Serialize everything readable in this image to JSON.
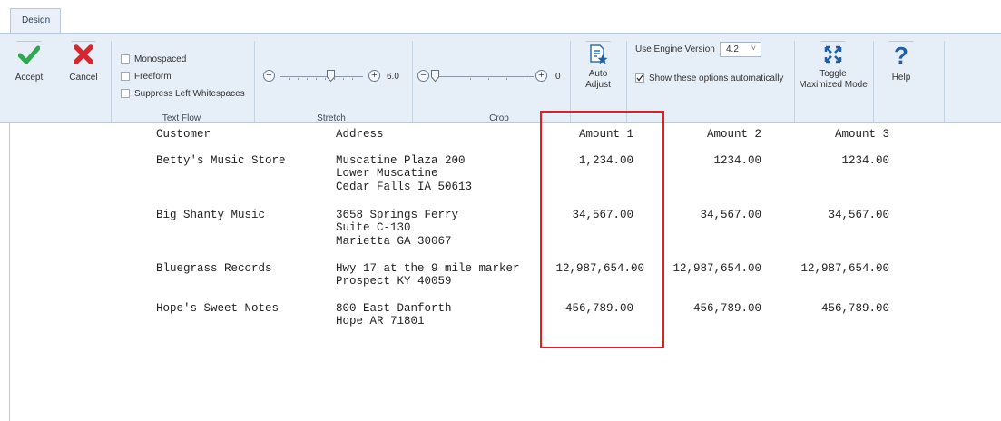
{
  "tabs": [
    {
      "label": "Design"
    }
  ],
  "ribbon": {
    "accept": "Accept",
    "cancel": "Cancel",
    "text_flow": {
      "options": [
        "Monospaced",
        "Freeform",
        "Suppress Left Whitespaces"
      ],
      "label": "Text Flow"
    },
    "stretch": {
      "value": "6.0",
      "label": "Stretch",
      "level": 0.6
    },
    "crop": {
      "value": "0",
      "label": "Crop",
      "level": 0.0
    },
    "auto_adjust": {
      "line1": "Auto",
      "line2": "Adjust"
    },
    "engine": {
      "label": "Use Engine Version",
      "version": "4.2",
      "show_options": "Show these options automatically",
      "show_checked": true
    },
    "toggle": {
      "line1": "Toggle",
      "line2": "Maximized Mode"
    },
    "help": "Help"
  },
  "report": {
    "headers": {
      "customer": "Customer",
      "address": "Address",
      "amount1": "Amount 1",
      "amount2": "Amount 2",
      "amount3": "Amount 3"
    },
    "rows": [
      {
        "customer": "Betty's Music Store",
        "address": [
          "Muscatine Plaza 200",
          "Lower Muscatine",
          "Cedar Falls IA 50613"
        ],
        "amount1": "1,234.00",
        "amount2": "1234.00",
        "amount3": "1234.00"
      },
      {
        "customer": "Big Shanty Music",
        "address": [
          "3658 Springs Ferry",
          "Suite C-130",
          "Marietta GA 30067"
        ],
        "amount1": "34,567.00",
        "amount2": "34,567.00",
        "amount3": "34,567.00"
      },
      {
        "customer": "Bluegrass Records",
        "address": [
          "Hwy 17 at the 9 mile marker",
          "Prospect KY 40059"
        ],
        "amount1": "12,987,654.00",
        "amount2": "12,987,654.00",
        "amount3": "12,987,654.00"
      },
      {
        "customer": "Hope's Sweet Notes",
        "address": [
          "800 East Danforth",
          "Hope AR 71801"
        ],
        "amount1": "456,789.00",
        "amount2": "456,789.00",
        "amount3": "456,789.00"
      }
    ]
  },
  "colors": {
    "accept": "#2fa84f",
    "cancel": "#d8262e",
    "highlight": "#e02020",
    "help": "#1e5fa8"
  }
}
